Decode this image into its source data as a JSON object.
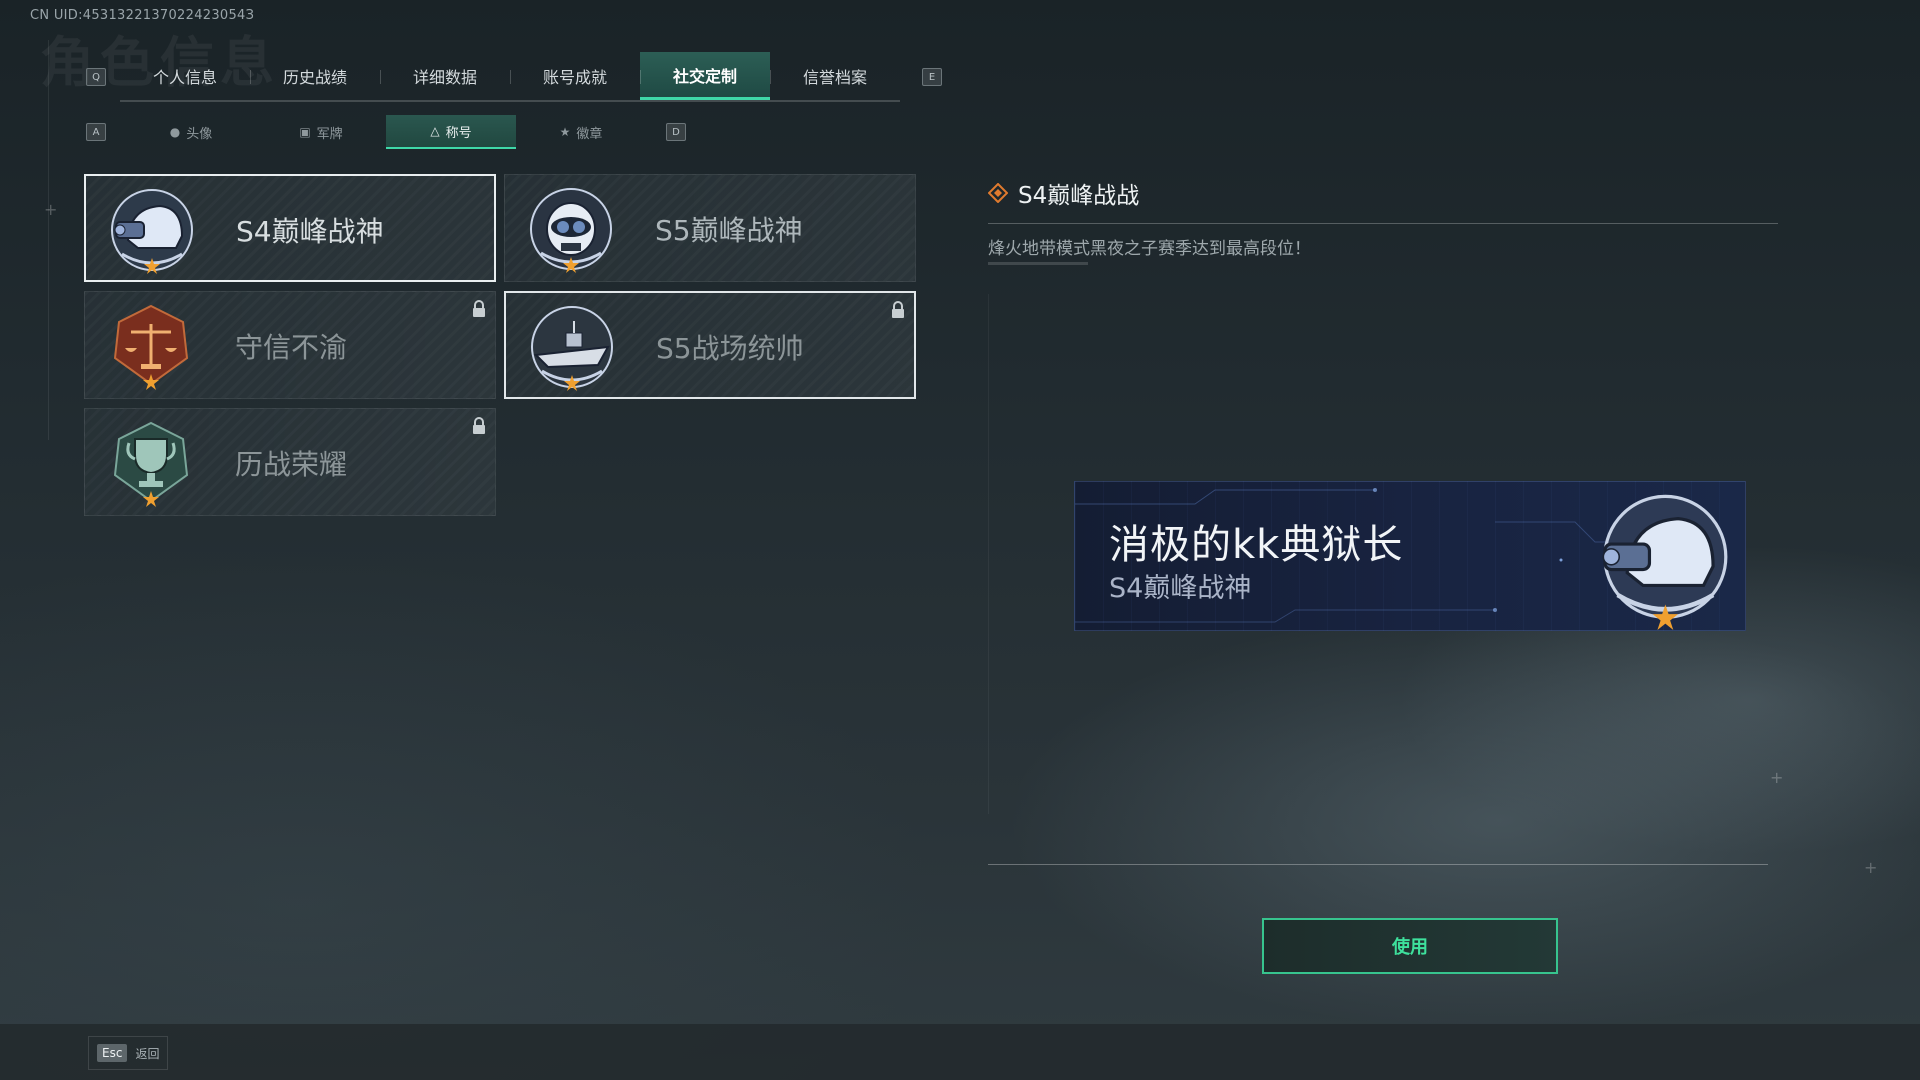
{
  "uid": "CN UID:4531322137022423054З",
  "header": {
    "ghost_title": "角色信息"
  },
  "main_tabs": {
    "left_key": "Q",
    "right_key": "E",
    "items": [
      {
        "label": "个人信息"
      },
      {
        "label": "历史战绩"
      },
      {
        "label": "详细数据"
      },
      {
        "label": "账号成就"
      },
      {
        "label": "社交定制",
        "active": true
      },
      {
        "label": "信誉档案"
      }
    ]
  },
  "sub_tabs": {
    "left_key": "A",
    "right_key": "D",
    "items": [
      {
        "label": "头像",
        "icon": "person-icon"
      },
      {
        "label": "军牌",
        "icon": "dogtag-icon"
      },
      {
        "label": "称号",
        "icon": "triangle-icon",
        "active": true
      },
      {
        "label": "徽章",
        "icon": "badge-icon"
      }
    ]
  },
  "titles": [
    {
      "name": "S4巅峰战神",
      "emblem": "helmet-nightvision-icon",
      "state": "selected"
    },
    {
      "name": "S5巅峰战神",
      "emblem": "skull-goggles-icon",
      "state": "normal"
    },
    {
      "name": "守信不渝",
      "emblem": "scales-icon",
      "state": "locked"
    },
    {
      "name": "S5战场统帅",
      "emblem": "boat-icon",
      "state": "locked-hover"
    },
    {
      "name": "历战荣耀",
      "emblem": "trophy-icon",
      "state": "locked"
    }
  ],
  "detail": {
    "title": "S4巅峰战战",
    "description": "烽火地带模式黑夜之子赛季达到最高段位！"
  },
  "nameplate": {
    "player_name": "消极的kk典狱长",
    "title": "S4巅峰战神",
    "emblem": "helmet-nightvision-icon"
  },
  "actions": {
    "use_label": "使用"
  },
  "footer": {
    "esc_key": "Esc",
    "back_label": "返回"
  },
  "colors": {
    "accent": "#3fd8a8",
    "use_button": "#37c48e",
    "plate_bg": "#182340"
  }
}
